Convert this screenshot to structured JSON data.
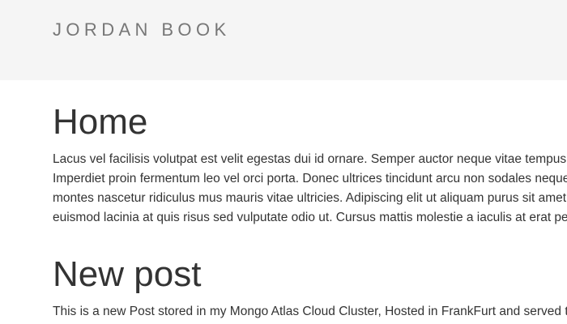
{
  "header": {
    "brand": "JORDAN BOOK"
  },
  "posts": [
    {
      "title": "Home",
      "lines": [
        "Lacus vel facilisis volutpat est velit egestas dui id ornare. Semper auctor neque vitae tempus quam.",
        "Imperdiet proin fermentum leo vel orci porta. Donec ultrices tincidunt arcu non sodales neque sodales.",
        "montes nascetur ridiculus mus mauris vitae ultricies. Adipiscing elit ut aliquam purus sit amet luctus.",
        "euismod lacinia at quis risus sed vulputate odio ut. Cursus mattis molestie a iaculis at erat pellentesque."
      ]
    },
    {
      "title": "New post",
      "lines": [
        "This is a new Post stored in my Mongo Atlas Cloud Cluster, Hosted in FrankFurt and served to you."
      ]
    }
  ],
  "colors": {
    "header_bg": "#f5f5f5",
    "brand_text": "#777777",
    "body_text": "#333333",
    "page_bg": "#ffffff"
  }
}
